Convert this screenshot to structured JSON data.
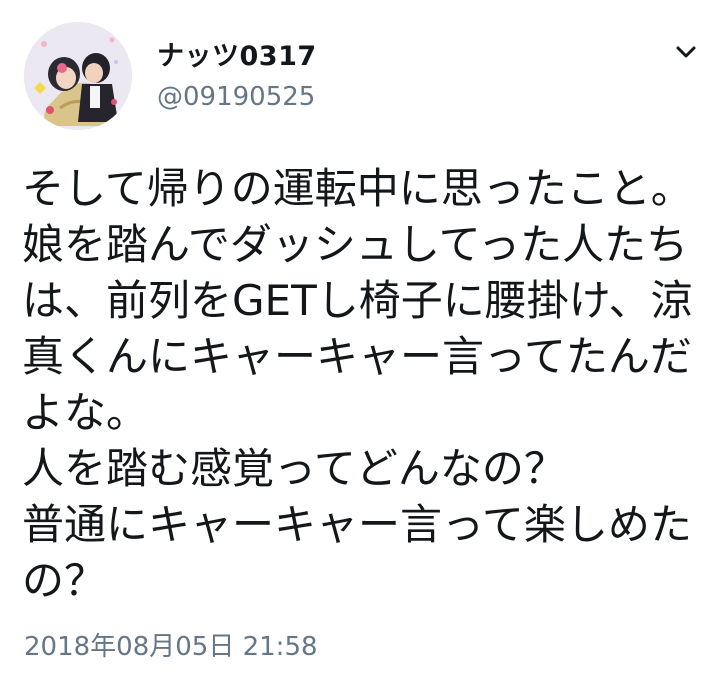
{
  "tweet": {
    "display_name": "ナッツ0317",
    "handle": "@09190525",
    "avatar_icon": "profile-photo-icon",
    "menu_icon": "chevron-down-icon",
    "lines": [
      "そして帰りの運転中に思ったこと。",
      "娘を踏んでダッシュしてった人たち",
      "は、前列をGETし椅子に腰掛け、涼",
      "真くんにキャーキャー言ってたんだ",
      "よな。",
      "人を踏む感覚ってどんなの？",
      "普通にキャーキャー言って楽しめた",
      "の？"
    ],
    "timestamp": "2018年08月05日 21:58"
  },
  "colors": {
    "text": "#14171a",
    "secondary": "#657786",
    "background": "#ffffff"
  }
}
